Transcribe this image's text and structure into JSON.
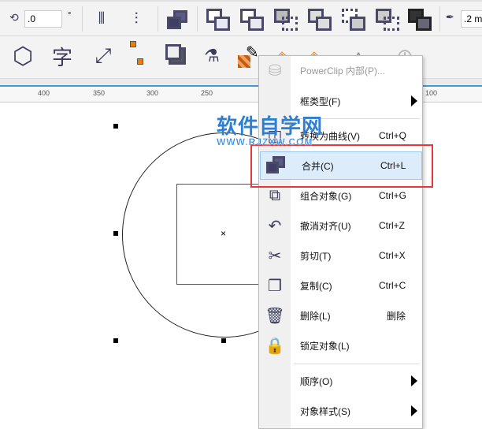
{
  "toolbar": {
    "rotation_value": ".0",
    "degree_symbol": "°",
    "outline_width": ".2 m"
  },
  "ruler": {
    "labels": [
      "400",
      "350",
      "300",
      "250",
      "100"
    ]
  },
  "context_menu": {
    "items": [
      {
        "label": "PowerClip 内部(P)...",
        "shortcut": "",
        "disabled": true,
        "icon": "powerclip-icon"
      },
      {
        "label": "框类型(F)",
        "shortcut": "",
        "submenu": true
      },
      {
        "label": "转换为曲线(V)",
        "shortcut": "Ctrl+Q",
        "icon": "convert-curve-icon"
      },
      {
        "label": "合并(C)",
        "shortcut": "Ctrl+L",
        "icon": "combine-icon",
        "highlighted": true
      },
      {
        "label": "组合对象(G)",
        "shortcut": "Ctrl+G",
        "icon": "group-icon"
      },
      {
        "label": "撤消对齐(U)",
        "shortcut": "Ctrl+Z",
        "icon": "undo-icon"
      },
      {
        "label": "剪切(T)",
        "shortcut": "Ctrl+X",
        "icon": "scissors-icon"
      },
      {
        "label": "复制(C)",
        "shortcut": "Ctrl+C",
        "icon": "copy-icon"
      },
      {
        "label": "删除(L)",
        "shortcut": "删除",
        "icon": "trash-icon"
      },
      {
        "label": "锁定对象(L)",
        "shortcut": "",
        "icon": "lock-icon"
      },
      {
        "label": "顺序(O)",
        "shortcut": "",
        "submenu": true
      },
      {
        "label": "对象样式(S)",
        "shortcut": "",
        "submenu": true
      }
    ]
  },
  "watermark": {
    "title": "软件自学网",
    "url": "WWW.RJZXW.COM"
  },
  "colors": {
    "highlight": "#dcecfb",
    "red_box": "#e8373a",
    "accent": "#3a9be0"
  }
}
